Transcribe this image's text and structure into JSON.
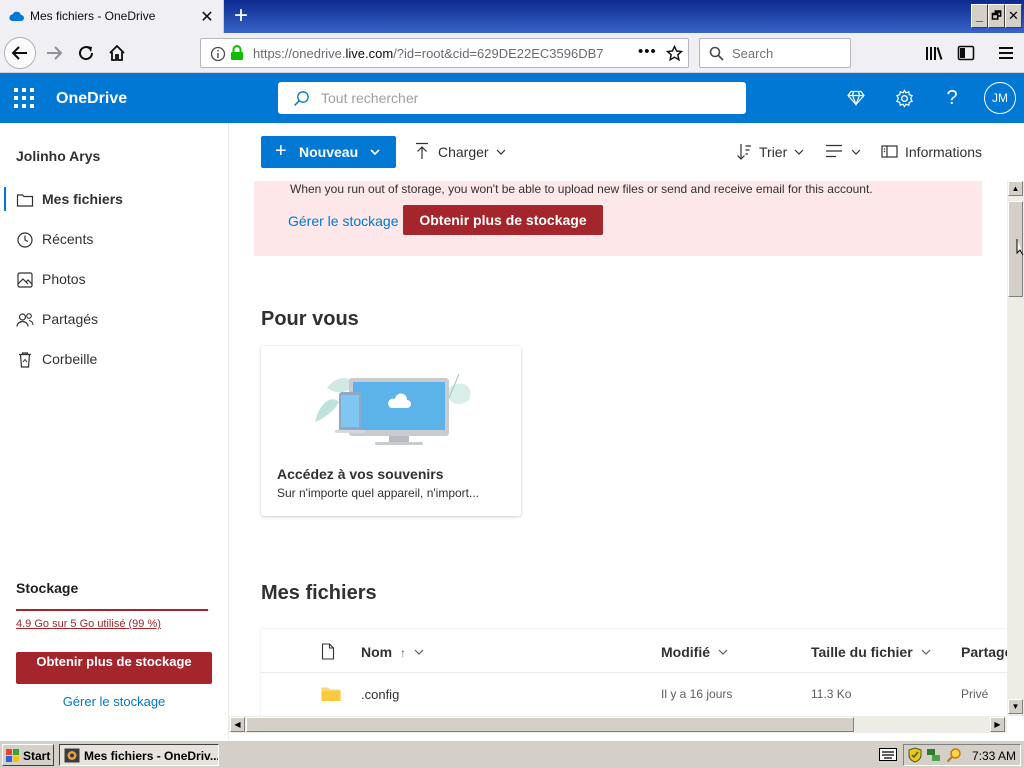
{
  "browser": {
    "tab_title": "Mes fichiers - OneDrive",
    "tab_close": "✕",
    "new_tab": "+",
    "url_prefix": "https://onedrive.",
    "url_host": "live.com",
    "url_rest": "/?id=root&cid=629DE22EC3596DB7",
    "search_placeholder": "Search",
    "window_controls": [
      "_",
      "🗗",
      "✕"
    ]
  },
  "header": {
    "brand": "OneDrive",
    "search_placeholder": "Tout rechercher",
    "avatar_initials": "JM"
  },
  "sidebar": {
    "username": "Jolinho Arys",
    "items": [
      {
        "label": "Mes fichiers",
        "icon": "folder-icon",
        "selected": true
      },
      {
        "label": "Récents",
        "icon": "clock-icon"
      },
      {
        "label": "Photos",
        "icon": "photo-icon"
      },
      {
        "label": "Partagés",
        "icon": "people-icon"
      },
      {
        "label": "Corbeille",
        "icon": "recycle-bin-icon"
      }
    ],
    "storage": {
      "title": "Stockage",
      "usage_text": "4.9 Go sur 5 Go utilisé (99 %)",
      "usage_fraction": 0.99,
      "button_label": "Obtenir plus de stockage",
      "manage_link": "Gérer le stockage"
    }
  },
  "commandbar": {
    "new_label": "Nouveau",
    "upload_label": "Charger",
    "sort_label": "Trier",
    "info_label": "Informations"
  },
  "banner": {
    "message": "When you run out of storage, you won't be able to upload new files or send and receive email for this account.",
    "manage_link": "Gérer le stockage",
    "button_label": "Obtenir plus de stockage"
  },
  "for_you": {
    "heading": "Pour vous",
    "card_title": "Accédez à vos souvenirs",
    "card_subtitle": "Sur n'importe quel appareil, n'import..."
  },
  "files": {
    "heading": "Mes fichiers",
    "columns": [
      "Nom",
      "Modifié",
      "Taille du fichier",
      "Partage"
    ],
    "sort_arrow": "↑",
    "rows": [
      {
        "name": ".config",
        "modified": "Il y a 16 jours",
        "size": "11.3 Ko",
        "sharing": "Privé"
      }
    ]
  },
  "taskbar": {
    "start_label": "Start",
    "task_label": "Mes fichiers - OneDriv...",
    "clock": "7:33 AM"
  },
  "colors": {
    "brand_blue": "#0078d4",
    "alert_red": "#a4262c",
    "banner_bg": "#fde7e9"
  }
}
